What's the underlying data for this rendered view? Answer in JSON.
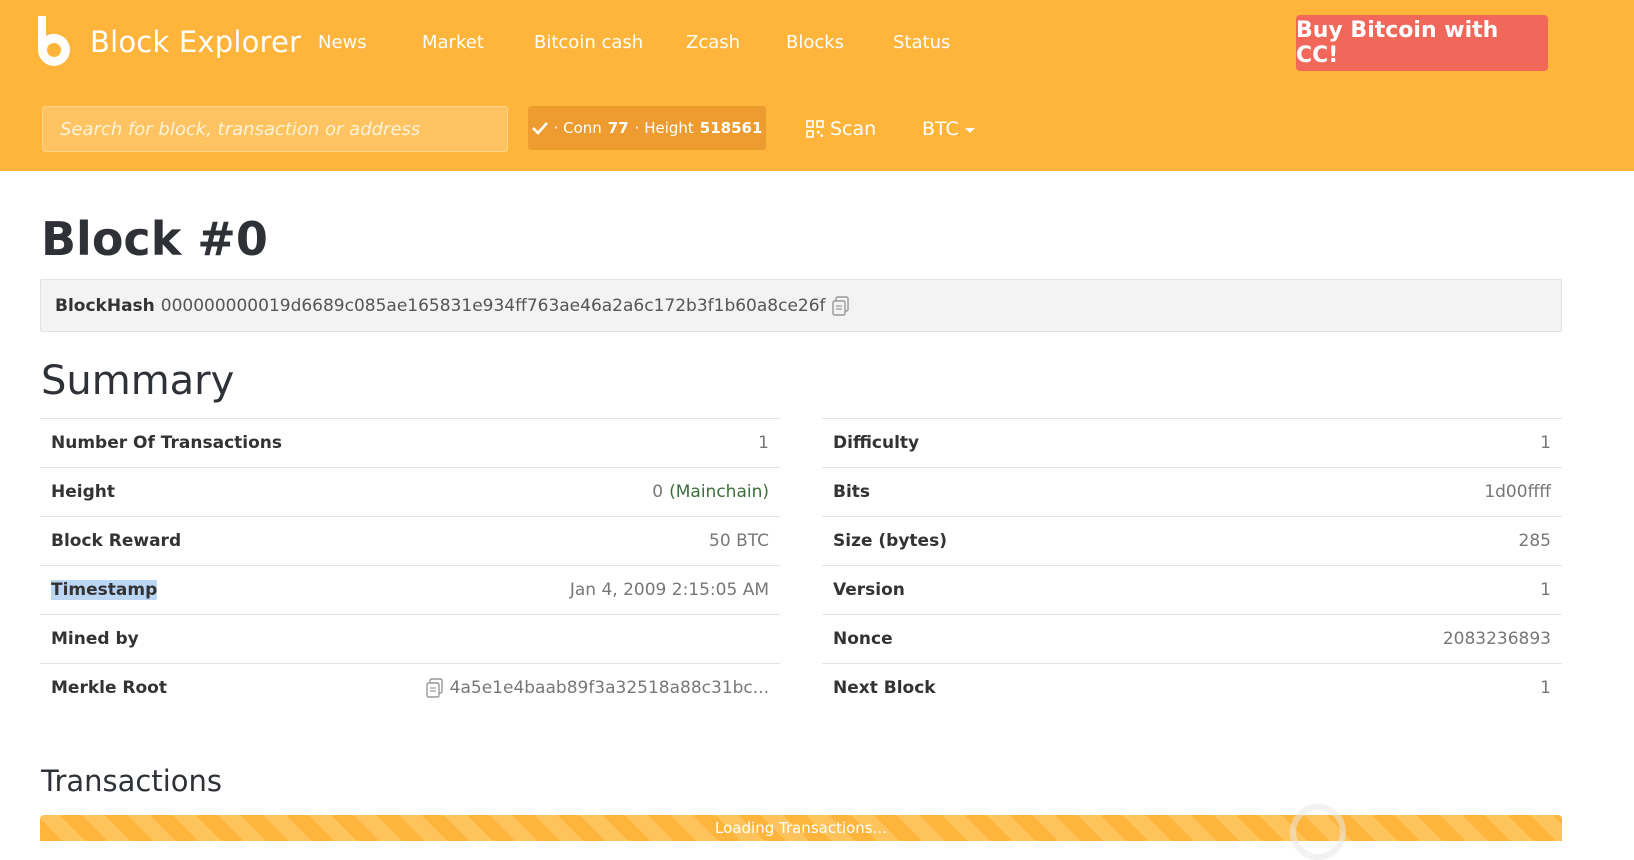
{
  "header": {
    "logo_text": "Block Explorer",
    "nav": [
      "News",
      "Market",
      "Bitcoin cash",
      "Zcash",
      "Blocks",
      "Status"
    ],
    "buy_button": "Buy Bitcoin with CC!",
    "search_placeholder": "Search for block, transaction or address",
    "status": {
      "conn_label": "· Conn",
      "conn_value": "77",
      "height_label": "· Height",
      "height_value": "518561"
    },
    "scan_label": "Scan",
    "currency": "BTC"
  },
  "block": {
    "title": "Block #0",
    "hash_label": "BlockHash",
    "hash": "000000000019d6689c085ae165831e934ff763ae46a2a6c172b3f1b60a8ce26f"
  },
  "summary": {
    "title": "Summary",
    "left": [
      {
        "label": "Number Of Transactions",
        "value": "1"
      },
      {
        "label": "Height",
        "value": "0",
        "extra": "(Mainchain)"
      },
      {
        "label": "Block Reward",
        "value": "50 BTC"
      },
      {
        "label": "Timestamp",
        "value": "Jan 4, 2009 2:15:05 AM"
      },
      {
        "label": "Mined by",
        "value": ""
      },
      {
        "label": "Merkle Root",
        "value": "4a5e1e4baab89f3a32518a88c31bc..."
      }
    ],
    "right": [
      {
        "label": "Difficulty",
        "value": "1"
      },
      {
        "label": "Bits",
        "value": "1d00ffff"
      },
      {
        "label": "Size (bytes)",
        "value": "285"
      },
      {
        "label": "Version",
        "value": "1"
      },
      {
        "label": "Nonce",
        "value": "2083236893"
      },
      {
        "label": "Next Block",
        "value": "1"
      }
    ]
  },
  "transactions": {
    "title": "Transactions",
    "loading_text": "Loading Transactions..."
  },
  "colors": {
    "brand": "#ffb53b",
    "cta": "#f1675a",
    "link": "#2a6fb1"
  }
}
